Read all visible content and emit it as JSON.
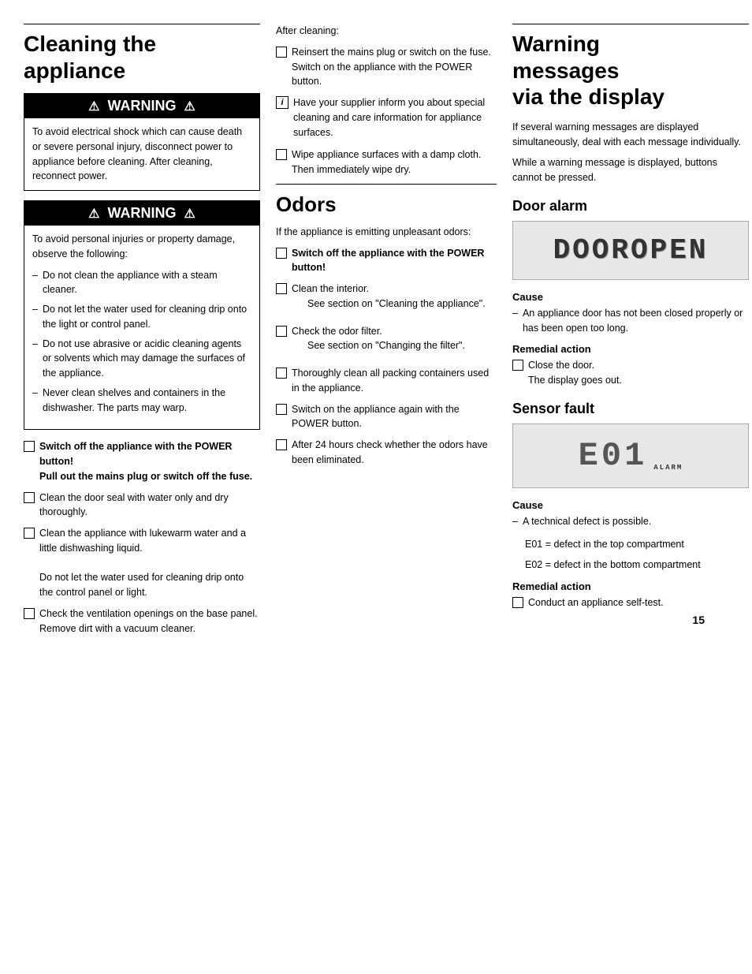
{
  "page": {
    "number": "15"
  },
  "col1": {
    "title": "Cleaning the\nappliance",
    "warning1": {
      "header": "WARNING",
      "body": "To avoid electrical shock which can cause death or severe personal injury, disconnect power to appliance before cleaning. After cleaning, reconnect power."
    },
    "warning2": {
      "header": "WARNING",
      "body_intro": "To avoid personal injuries or property damage, observe the following:",
      "dash_items": [
        "Do not clean the appliance with a steam cleaner.",
        "Do not let the water used for cleaning drip onto the light or control panel.",
        "Do not use abrasive or acidic cleaning agents or solvents which may damage the surfaces of the appliance.",
        "Never clean shelves and containers in the dishwasher. The parts may warp."
      ]
    },
    "bullets": [
      {
        "bold": "Switch off the appliance with the POWER button!\nPull out the mains plug or switch off the fuse.",
        "text": ""
      },
      {
        "bold": "",
        "text": "Clean the door seal with water only and dry thoroughly."
      },
      {
        "bold": "",
        "text": "Clean the appliance with lukewarm water and a little dishwashing liquid.\n\nDo not let the water used for cleaning drip onto the control panel or light."
      },
      {
        "bold": "",
        "text": "Check the ventilation openings on the base panel. Remove dirt with a vacuum cleaner."
      }
    ]
  },
  "col2": {
    "after_cleaning_label": "After cleaning:",
    "after_cleaning_bullets": [
      {
        "text": "Reinsert the mains plug or switch on the fuse. Switch on the appliance with the POWER button."
      }
    ],
    "info_text": "Have your supplier inform you about special cleaning and care information for appliance surfaces.",
    "more_bullets": [
      {
        "text": "Wipe appliance surfaces with a damp cloth.\nThen immediately wipe dry."
      }
    ],
    "odors_title": "Odors",
    "odors_intro": "If the appliance is emitting unpleasant odors:",
    "odors_bullets": [
      {
        "bold": "Switch off the appliance with the POWER button!",
        "text": ""
      },
      {
        "bold": "",
        "text": "Clean the interior.",
        "sub": "See section on \"Cleaning the appliance\"."
      },
      {
        "bold": "",
        "text": "Check the odor filter.",
        "sub": "See section on \"Changing the filter\"."
      },
      {
        "bold": "",
        "text": "Thoroughly clean all packing containers used in the appliance."
      },
      {
        "bold": "",
        "text": "Switch on the appliance again with the POWER button."
      },
      {
        "bold": "",
        "text": "After 24 hours check whether the odors have been eliminated."
      }
    ]
  },
  "col3": {
    "title": "Warning\nmessages\nvia the display",
    "intro1": "If several warning messages are displayed simultaneously, deal with each message individually.",
    "intro2": "While a warning message is displayed, buttons cannot be pressed.",
    "door_alarm": {
      "title": "Door alarm",
      "display_text": "DOOROPEN",
      "cause_label": "Cause",
      "cause_item": "An appliance door has not been closed properly or has been open too long.",
      "remedial_label": "Remedial action",
      "remedial_item": "Close the door.\nThe display goes out."
    },
    "sensor_fault": {
      "title": "Sensor fault",
      "display_text": "E01",
      "alarm_label": "ALARM",
      "cause_label": "Cause",
      "cause_item": "A technical defect is possible.",
      "cause_sub1": "E01 = defect in the top compartment",
      "cause_sub2": "E02 = defect in the bottom compartment",
      "remedial_label": "Remedial action",
      "remedial_item": "Conduct an appliance self-test."
    }
  }
}
